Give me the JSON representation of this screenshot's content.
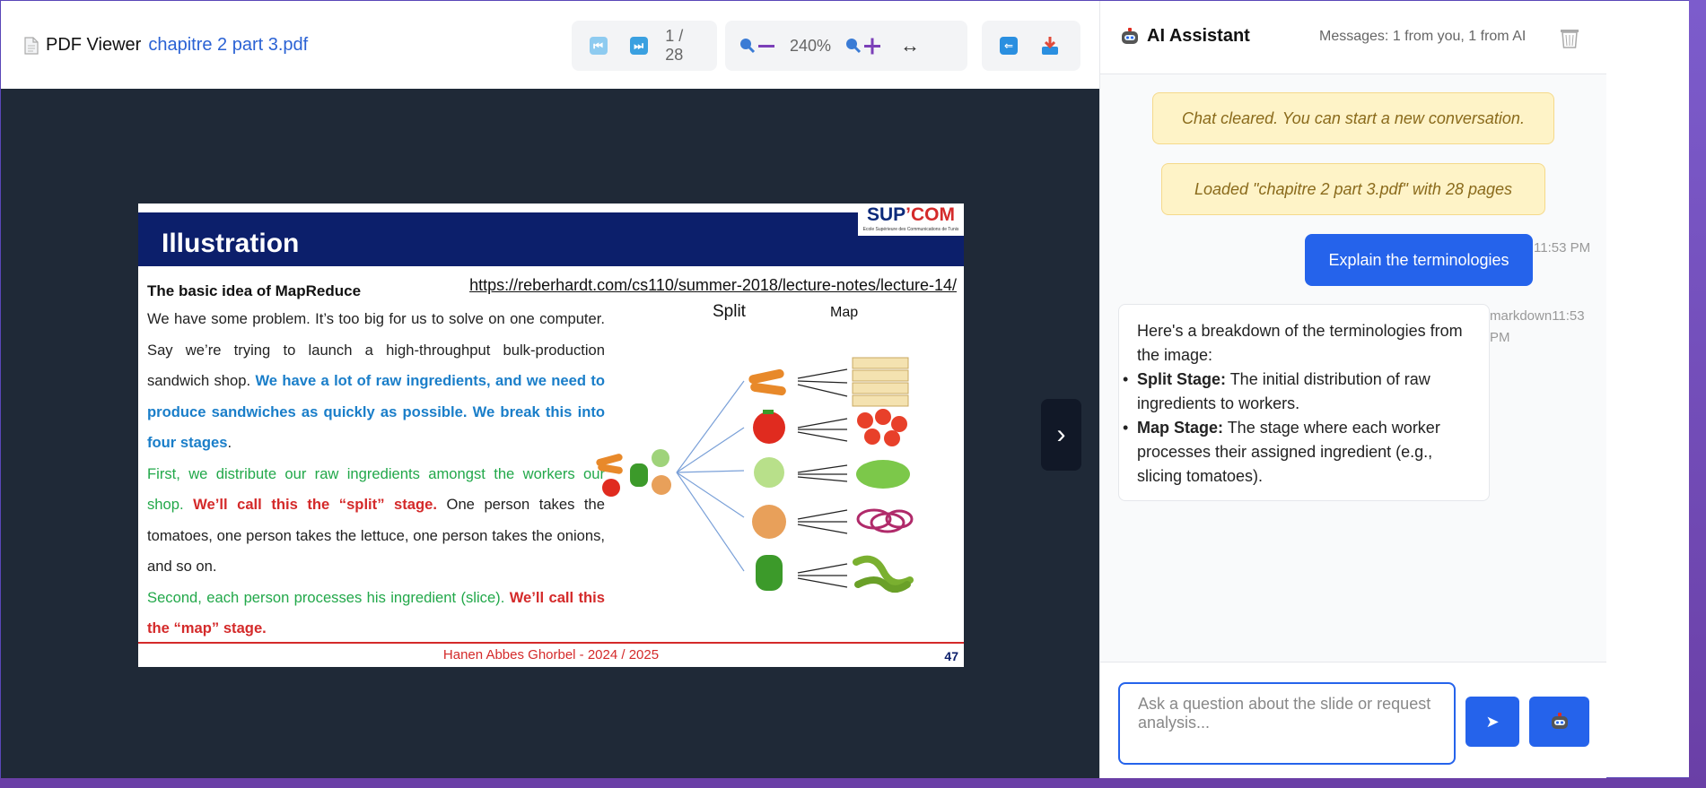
{
  "viewer": {
    "app_label": "PDF Viewer",
    "file_name": "chapitre 2 part 3.pdf",
    "page_indicator": "1 / 28",
    "zoom_level": "240%",
    "fit_width_glyph": "↔"
  },
  "slide": {
    "title": "Illustration",
    "logo_main": "SUP",
    "logo_accent": "’COM",
    "logo_sub": "Ecole Supérieure des Communications de Tunis",
    "subtitle": "The basic idea of MapReduce",
    "url": "https://reberhardt.com/cs110/summer-2018/lecture-notes/lecture-14/",
    "p1_plain": "We have some problem. It’s too big for us to solve on one computer. Say we’re trying to launch a high-throughput bulk-production sandwich shop. ",
    "p1_blue": "We have a lot of raw ingredients, and we need to produce sandwiches as quickly as possible. We break this into four stages",
    "p1_end": ".",
    "p2_green": "First, we distribute our raw ingredients amongst the workers our shop. ",
    "p2_red": "We’ll call this the “split” stage.",
    "p2_plain": " One person takes the tomatoes, one person takes the lettuce, one person takes the onions, and so on.",
    "p3_green": "Second, each person processes his ingredient (slice). ",
    "p3_red": "We’ll call this the “map” stage.",
    "split_label": "Split",
    "map_label": "Map",
    "footer": "Hanen Abbes Ghorbel - 2024 / 2025",
    "page_number": "47"
  },
  "chat": {
    "title": "AI Assistant",
    "message_count": "Messages: 1 from you, 1 from AI",
    "system_messages": [
      "Chat cleared. You can start a new conversation.",
      "Loaded \"chapitre 2 part 3.pdf\" with 28 pages"
    ],
    "user_message": "Explain the terminologies",
    "user_time": "11:53 PM",
    "ai_meta_1": "markdown11:53",
    "ai_meta_2": "PM",
    "ai_intro": "Here's a breakdown of the terminologies from the image:",
    "ai_items": [
      {
        "term": "Split Stage:",
        "text": " The initial distribution of raw ingredients to workers."
      },
      {
        "term": "Map Stage:",
        "text": " The stage where each worker processes their assigned ingredient (e.g., slicing tomatoes)."
      }
    ],
    "input_placeholder": "Ask a question about the slide or request analysis...",
    "send_glyph": "➤"
  },
  "colors": {
    "accent": "#2563eb",
    "slide_header": "#0c1f6b",
    "slide_red": "#d42a2a",
    "slide_blue": "#1a7ec9",
    "slide_green": "#22a84a",
    "viewer_bg": "#1f2937"
  }
}
